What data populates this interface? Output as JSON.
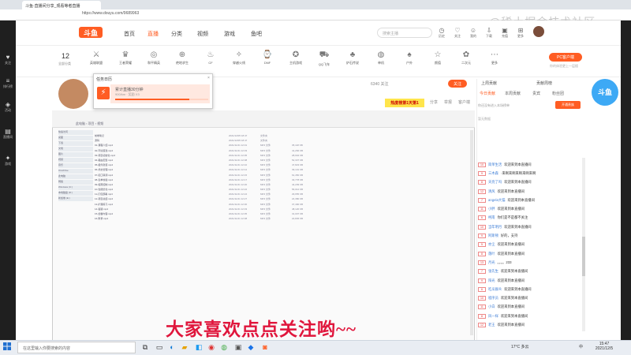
{
  "browser": {
    "tab_title": "斗鱼·直播间分享_观看等者直播",
    "url": "https://www.douyu.com/9689963",
    "watermark": "@稀土掘金技术社区"
  },
  "left_sidebar": [
    {
      "icon": "heart-icon",
      "label": "关注"
    },
    {
      "icon": "list-icon",
      "label": "排行榜"
    },
    {
      "icon": "gift-icon",
      "label": "活动"
    },
    {
      "icon": "calendar-icon",
      "label": "直播间"
    },
    {
      "icon": "game-icon",
      "label": "游戏"
    }
  ],
  "nav": {
    "logo": "斗鱼",
    "links": [
      "首页",
      "直播",
      "分类",
      "视频",
      "游戏",
      "鱼吧"
    ],
    "active": "直播",
    "search_placeholder": "搜索主播",
    "top_icons": [
      "历史",
      "关注",
      "我的",
      "下载",
      "充值",
      "更多"
    ]
  },
  "categories": {
    "count": "12",
    "count_label": "全部分类",
    "items": [
      "英雄联盟",
      "王者荣耀",
      "和平精英",
      "绝地求生",
      "CF",
      "穿越火线",
      "DNF",
      "主机游戏",
      "QQ飞车",
      "炉石传说",
      "单机",
      "户外",
      "颜值",
      "二次元",
      "更多"
    ],
    "pc_button": "PC客户端",
    "pc_sub": "你的体验更上一层楼"
  },
  "streamer": {
    "hud": "6340    关注",
    "follow": "关注",
    "hot_badge": "热度榜第1天第1",
    "meta": [
      "分享",
      "举报",
      "客户端"
    ]
  },
  "popup": {
    "title": "任务日历",
    "close": "×",
    "name": "累计直播30分钟",
    "sub": "900/km · 奖励 X3",
    "progress": 0.8
  },
  "explorer": {
    "title_path": "此电脑 › 项目 › 视频",
    "side": [
      "快速访问",
      "桌面",
      "下载",
      "文档",
      "图片",
      "视频",
      "音乐",
      "OneDrive",
      "此电脑",
      "网络",
      "Windows (C:)",
      "本地磁盘 (D:)",
      "新加卷 (E:)"
    ],
    "rows": [
      {
        "name": "前端笔记",
        "date": "2021/12/05 18:47",
        "type": "文件夹",
        "size": ""
      },
      {
        "name": "源码",
        "date": "2021/12/05 18:47",
        "type": "文件夹",
        "size": ""
      },
      {
        "name": "01-课程介绍.mp4",
        "date": "2021/11/21 12:01",
        "type": "MP4 文件",
        "size": "35,118 KB"
      },
      {
        "name": "02-环境搭建.mp4",
        "date": "2021/11/21 12:03",
        "type": "MP4 文件",
        "size": "41,266 KB"
      },
      {
        "name": "03-项目初始化.mp4",
        "date": "2021/11/21 12:05",
        "type": "MP4 文件",
        "size": "28,904 KB"
      },
      {
        "name": "04-路由配置.mp4",
        "date": "2021/11/21 12:08",
        "type": "MP4 文件",
        "size": "52,337 KB"
      },
      {
        "name": "05-组件封装.mp4",
        "date": "2021/11/21 12:10",
        "type": "MP4 文件",
        "size": "47,823 KB"
      },
      {
        "name": "06-状态管理.mp4",
        "date": "2021/11/21 12:12",
        "type": "MP4 文件",
        "size": "39,101 KB"
      },
      {
        "name": "07-接口联调.mp4",
        "date": "2021/11/21 12:15",
        "type": "MP4 文件",
        "size": "61,450 KB"
      },
      {
        "name": "08-表单校验.mp4",
        "date": "2021/11/21 12:17",
        "type": "MP4 文件",
        "size": "33,778 KB"
      },
      {
        "name": "09-权限控制.mp4",
        "date": "2021/11/21 12:20",
        "type": "MP4 文件",
        "size": "44,209 KB"
      },
      {
        "name": "10-性能优化.mp4",
        "date": "2021/11/21 12:22",
        "type": "MP4 文件",
        "size": "56,012 KB"
      },
      {
        "name": "11-打包部署.mp4",
        "date": "2021/11/21 12:24",
        "type": "MP4 文件",
        "size": "29,655 KB"
      },
      {
        "name": "12-项目总结.mp4",
        "date": "2021/11/21 12:27",
        "type": "MP4 文件",
        "size": "24,380 KB"
      },
      {
        "name": "13-扩展练习.mp4",
        "date": "2021/11/21 12:30",
        "type": "MP4 文件",
        "size": "37,490 KB"
      },
      {
        "name": "14-答疑.mp4",
        "date": "2021/11/21 12:33",
        "type": "MP4 文件",
        "size": "48,120 KB"
      },
      {
        "name": "15-加餐内容.mp4",
        "date": "2021/11/21 12:35",
        "type": "MP4 文件",
        "size": "31,007 KB"
      },
      {
        "name": "16-附录.mp4",
        "date": "2021/11/21 12:38",
        "type": "MP4 文件",
        "size": "22,845 KB"
      }
    ]
  },
  "danmu": "大家喜欢点点关注哟~~",
  "right_panel": {
    "top_left": "上周贡献",
    "top_right": "贡献周榜",
    "tabs": [
      "今日贡献",
      "本周贡献",
      "贵宾",
      "粉丝团"
    ],
    "active_tab": "今日贡献",
    "rank_note": "你还没有进入本场榜单",
    "rank_button": "开通贵族",
    "rank_empty": "暂无数据",
    "mascot": "斗鱼",
    "chat": [
      {
        "lv": "10",
        "name": "简单生活",
        "text": "欢迎来到本直播间"
      },
      {
        "lv": "9",
        "name": "三木森",
        "text": "·来啊来啊来啊来啊来啊"
      },
      {
        "lv": "8",
        "name": "天亮了吗",
        "text": "欢迎来到本直播间"
      },
      {
        "lv": "12",
        "name": "清风",
        "text": "欢迎来到本直播间"
      },
      {
        "lv": "7",
        "name": "angela大猫",
        "text": "欢迎来到本直播间"
      },
      {
        "lv": "11",
        "name": "小胖",
        "text": "欢迎来到本直播间"
      },
      {
        "lv": "6",
        "name": "柯南",
        "text": "你们是不是都不关注"
      },
      {
        "lv": "10",
        "name": "当年明月",
        "text": "欢迎来到本直播间"
      },
      {
        "lv": "9",
        "name": "阿斯顿",
        "text": "好的，支持"
      },
      {
        "lv": "5",
        "name": "亦尘",
        "text": "欢迎来到本直播间"
      },
      {
        "lv": "8",
        "name": "落叶",
        "text": "欢迎来到本直播间"
      },
      {
        "lv": "13",
        "name": "月光",
        "text": "。。。。233"
      },
      {
        "lv": "7",
        "name": "张先生",
        "text": "欢迎来到本直播间"
      },
      {
        "lv": "9",
        "name": "阳光",
        "text": "欢迎来到本直播间"
      },
      {
        "lv": "6",
        "name": "吃瓜群众",
        "text": "欢迎来到本直播间"
      },
      {
        "lv": "10",
        "name": "程序员",
        "text": "欢迎来到本直播间"
      },
      {
        "lv": "11",
        "name": "小白",
        "text": "欢迎来到本直播间"
      },
      {
        "lv": "8",
        "name": "风一样",
        "text": "欢迎来到本直播间"
      },
      {
        "lv": "12",
        "name": "老王",
        "text": "欢迎来到本直播间"
      }
    ]
  },
  "taskbar": {
    "search_placeholder": "在这里输入你要搜索的内容",
    "weather": "17°C 多云",
    "lang": "中",
    "time": "15:47",
    "date": "2021/12/5"
  },
  "colors": {
    "accent": "#ff5d23",
    "danmu": "#e0163c"
  }
}
